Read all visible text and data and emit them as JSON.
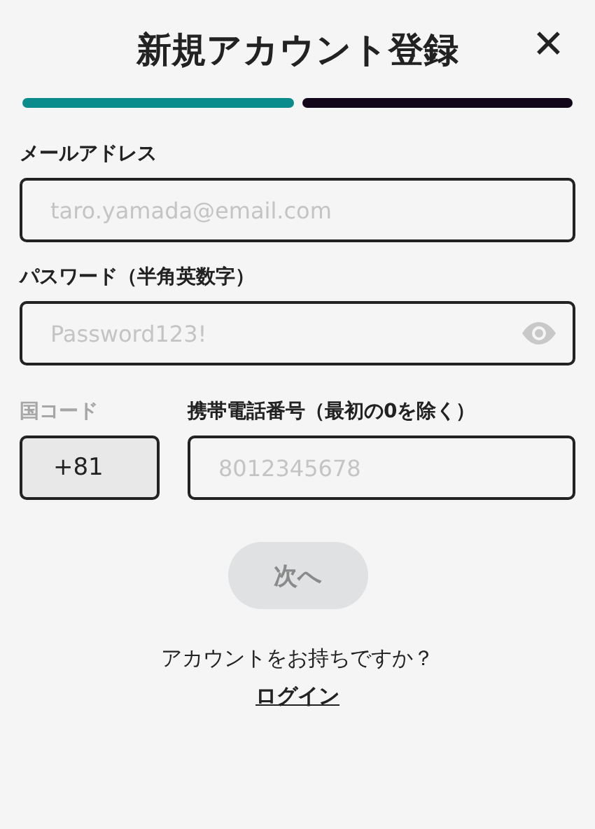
{
  "header": {
    "title": "新規アカウント登録",
    "close": "✕"
  },
  "progress": [
    {
      "complete": true
    },
    {
      "complete": false
    }
  ],
  "email": {
    "label": "メールアドレス",
    "placeholder": "taro.yamada@email.com"
  },
  "password": {
    "label": "パスワード（半角英数字）",
    "placeholder": "Password123!"
  },
  "country_code": {
    "label": "国コード",
    "value": "+81",
    "disabled": true
  },
  "phone": {
    "label": "携帯電話番号（最初の0を除く）",
    "placeholder": "8012345678"
  },
  "next_button": {
    "label": "次へ",
    "disabled": true
  },
  "footer": {
    "prompt": "アカウントをお持ちですか？",
    "link": "ログイン"
  }
}
